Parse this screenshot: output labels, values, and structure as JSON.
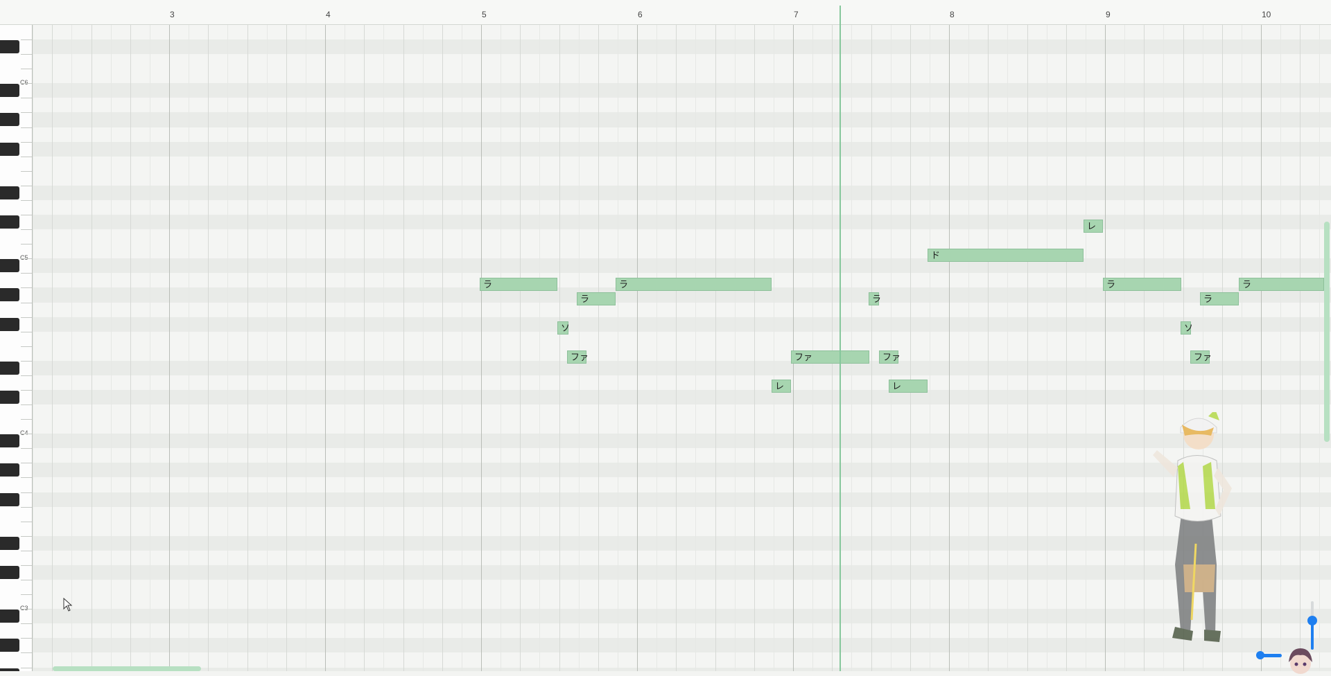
{
  "ruler": {
    "bars": [
      "3",
      "4",
      "5",
      "6",
      "7",
      "8",
      "9",
      "10"
    ]
  },
  "keyboard": {
    "octave_labels": [
      "C6",
      "C5",
      "C4",
      "C3"
    ]
  },
  "notes": [
    {
      "lyric": "ラ",
      "bar": "5"
    },
    {
      "lyric": "ラ",
      "bar": "5"
    },
    {
      "lyric": "ソ",
      "bar": "5"
    },
    {
      "lyric": "ファ",
      "bar": "5"
    },
    {
      "lyric": "ラ",
      "bar": "5"
    },
    {
      "lyric": "レ",
      "bar": "6"
    },
    {
      "lyric": "ファ",
      "bar": "7"
    },
    {
      "lyric": "ラ",
      "bar": "7"
    },
    {
      "lyric": "ファ",
      "bar": "7"
    },
    {
      "lyric": "レ",
      "bar": "7"
    },
    {
      "lyric": "ド",
      "bar": "7"
    },
    {
      "lyric": "レ",
      "bar": "8"
    },
    {
      "lyric": "ラ",
      "bar": "9"
    },
    {
      "lyric": "ソ",
      "bar": "9"
    },
    {
      "lyric": "ファ",
      "bar": "9"
    },
    {
      "lyric": "ラ",
      "bar": "9"
    },
    {
      "lyric": "ラ",
      "bar": "9"
    }
  ],
  "colors": {
    "note_fill": "#a7d5b0",
    "note_border": "#8dc09a",
    "playhead": "#86c79c",
    "zoom_accent": "#1e7ff0",
    "grid_background": "#f3f4f2"
  },
  "icons": {
    "cursor": "mouse-pointer-icon",
    "character": "character-illustration",
    "avatar": "singer-avatar-icon"
  }
}
